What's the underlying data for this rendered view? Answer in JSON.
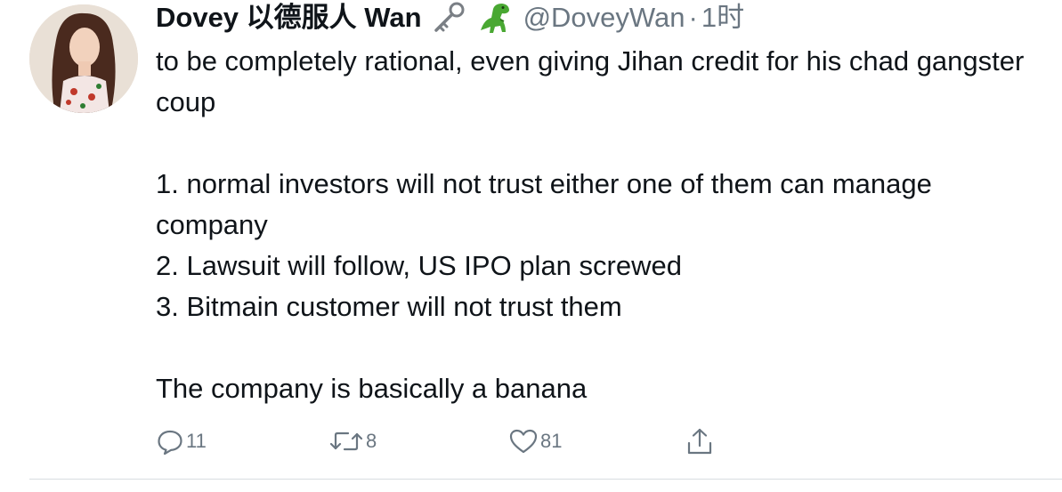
{
  "tweet": {
    "display_name": "Dovey 以德服人 Wan",
    "name_emojis": [
      "key-emoji",
      "t-rex-emoji"
    ],
    "handle": "@DoveyWan",
    "separator": "·",
    "timestamp": "1时",
    "body": {
      "paragraph_1": "to be completely rational, even giving Jihan credit for his chad gangster coup",
      "line_1": "1. normal investors will not trust either one of them can manage company",
      "line_2": "2. Lawsuit will follow, US IPO plan screwed",
      "line_3": "3. Bitmain customer will not trust them",
      "paragraph_3": "The company is basically a banana"
    },
    "actions": {
      "reply_count": "11",
      "retweet_count": "8",
      "like_count": "81"
    }
  },
  "colors": {
    "text": "#0f1419",
    "secondary": "#6a7681",
    "divider": "#d8dde1"
  }
}
